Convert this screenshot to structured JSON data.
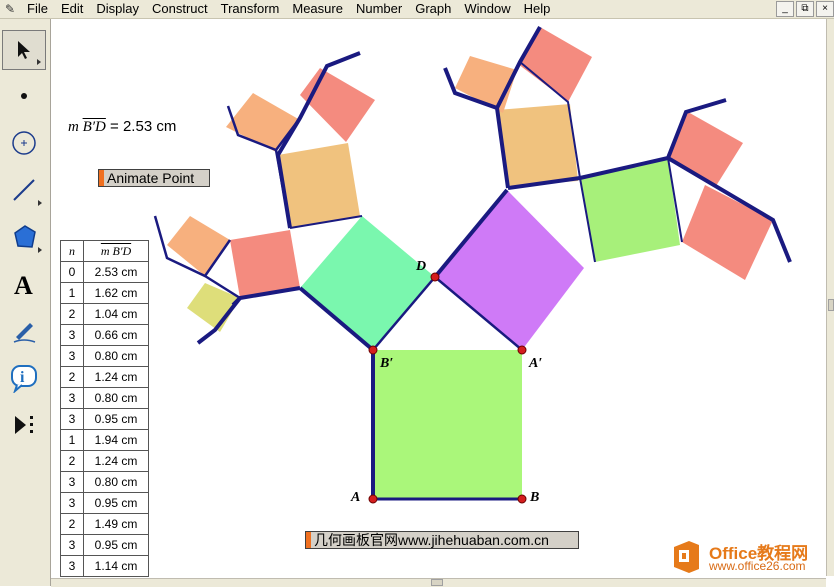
{
  "menubar": {
    "items": [
      "File",
      "Edit",
      "Display",
      "Construct",
      "Transform",
      "Measure",
      "Number",
      "Graph",
      "Window",
      "Help"
    ],
    "window_controls": [
      "_",
      "⧉",
      "×"
    ]
  },
  "toolbox": {
    "tools": [
      {
        "name": "arrow-select-tool",
        "icon": "arrow-icon",
        "selected": true
      },
      {
        "name": "point-tool",
        "icon": "point-icon"
      },
      {
        "name": "compass-tool",
        "icon": "circle-icon"
      },
      {
        "name": "straightedge-tool",
        "icon": "line-segment-icon"
      },
      {
        "name": "polygon-tool",
        "icon": "polygon-icon"
      },
      {
        "name": "text-tool",
        "icon": "text-A-icon"
      },
      {
        "name": "marker-tool",
        "icon": "pen-icon"
      },
      {
        "name": "information-tool",
        "icon": "info-icon"
      },
      {
        "name": "custom-tool",
        "icon": "custom-tool-icon"
      }
    ]
  },
  "sketch": {
    "measurement": {
      "prefix": "m ",
      "segment": "B′D",
      "value": " = 2.53 cm"
    },
    "animate_button": "Animate Point",
    "link_button": "几何画板官网www.jihehuaban.com.cn",
    "table": {
      "headers": [
        "n",
        "m B′D"
      ],
      "rows": [
        [
          "0",
          "2.53 cm"
        ],
        [
          "1",
          "1.62 cm"
        ],
        [
          "2",
          "1.04 cm"
        ],
        [
          "3",
          "0.66 cm"
        ],
        [
          "3",
          "0.80 cm"
        ],
        [
          "2",
          "1.24 cm"
        ],
        [
          "3",
          "0.80 cm"
        ],
        [
          "3",
          "0.95 cm"
        ],
        [
          "1",
          "1.94 cm"
        ],
        [
          "2",
          "1.24 cm"
        ],
        [
          "3",
          "0.80 cm"
        ],
        [
          "3",
          "0.95 cm"
        ],
        [
          "2",
          "1.49 cm"
        ],
        [
          "3",
          "0.95 cm"
        ],
        [
          "3",
          "1.14 cm"
        ]
      ]
    },
    "points": {
      "A": "A",
      "B": "B",
      "A_prime": "A′",
      "B_prime": "B′",
      "D": "D"
    },
    "colors": {
      "base_square": "#aaf77a",
      "left_square": "#7af7ae",
      "right_square": "#cf7af7",
      "peach": "#f0c27e",
      "salmon": "#f48b7f",
      "light_orange": "#f7b07e",
      "green": "#a7f07a",
      "olive": "#dede7a",
      "edge": "#1a1a80",
      "point": "#d41e1e"
    }
  },
  "watermark": {
    "title": "Office教程网",
    "url": "www.office26.com"
  }
}
